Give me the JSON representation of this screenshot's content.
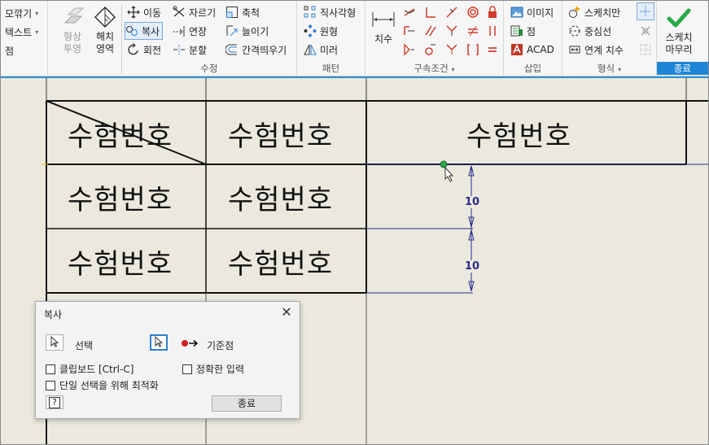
{
  "ribbon": {
    "panels": {
      "modify": "수정",
      "pattern": "패턴",
      "constrain": "구속조건",
      "insert": "삽입",
      "format": "형식",
      "exit": "종료"
    },
    "left_items": [
      "모깎기",
      "텍스트",
      "점"
    ],
    "shape_projection": [
      "형상",
      "투영"
    ],
    "hatch": [
      "해치",
      "영역"
    ],
    "modify_items": {
      "move": "이동",
      "trim": "자르기",
      "scale": "축척",
      "copy": "복사",
      "extend": "연장",
      "stretch": "늘이기",
      "rotate": "회전",
      "split": "분할",
      "offset": "간격띄우기"
    },
    "pattern_items": [
      "직사각형",
      "원형",
      "미러"
    ],
    "dimension": "치수",
    "insert_items": [
      "이미지",
      "점",
      "ACAD"
    ],
    "format_items": [
      "스케치만",
      "중심선",
      "연계 치수"
    ],
    "finish": [
      "스케치",
      "마무리"
    ]
  },
  "canvas": {
    "cell_label": "수험번호",
    "dimension_values": [
      "10",
      "10"
    ]
  },
  "dialog": {
    "title": "복사",
    "select_label": "선택",
    "base_point_label": "기준점",
    "clipboard_label": "클립보드 [Ctrl-C]",
    "precise_input_label": "정확한 입력",
    "optimize_label": "단일 선택을 위해 최적화",
    "help_label": "?",
    "done_label": "종료"
  },
  "colors": {
    "accent": "#1f86d6",
    "canvas_bg": "#ebe9de",
    "dimension": "#2a2a8a",
    "finish_check": "#2aa84a"
  }
}
